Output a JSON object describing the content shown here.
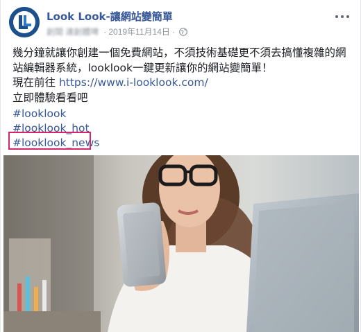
{
  "post": {
    "page_name": "Look Look-讓網站變簡單",
    "author_blurred": "創間 達創體啤",
    "date": "2019年11月14日",
    "separator": "·",
    "privacy_icon": "globe-icon",
    "more_icon": "more-dots-icon",
    "avatar_icon": "look-look-logo",
    "body_lines": [
      "幾分鐘就讓你創建一個免費網站，不須技術基礎更不須去搞懂複雜的網",
      "站編輯器系統，looklook一鍵更新讓你的網站變簡單！"
    ],
    "link_prefix": "現在前往 ",
    "link_url": "https://www.i-looklook.com/",
    "cta": "立即體驗看看吧",
    "hashtags": [
      "#looklook",
      "#looklook_hot",
      "#looklook_news"
    ],
    "photo_alt": "woman-looking-at-smartphone-photo"
  },
  "colors": {
    "link": "#385898",
    "highlight_box": "#d6256c",
    "meta_text": "#90949c",
    "avatar_bg": "#1c4f8b"
  }
}
